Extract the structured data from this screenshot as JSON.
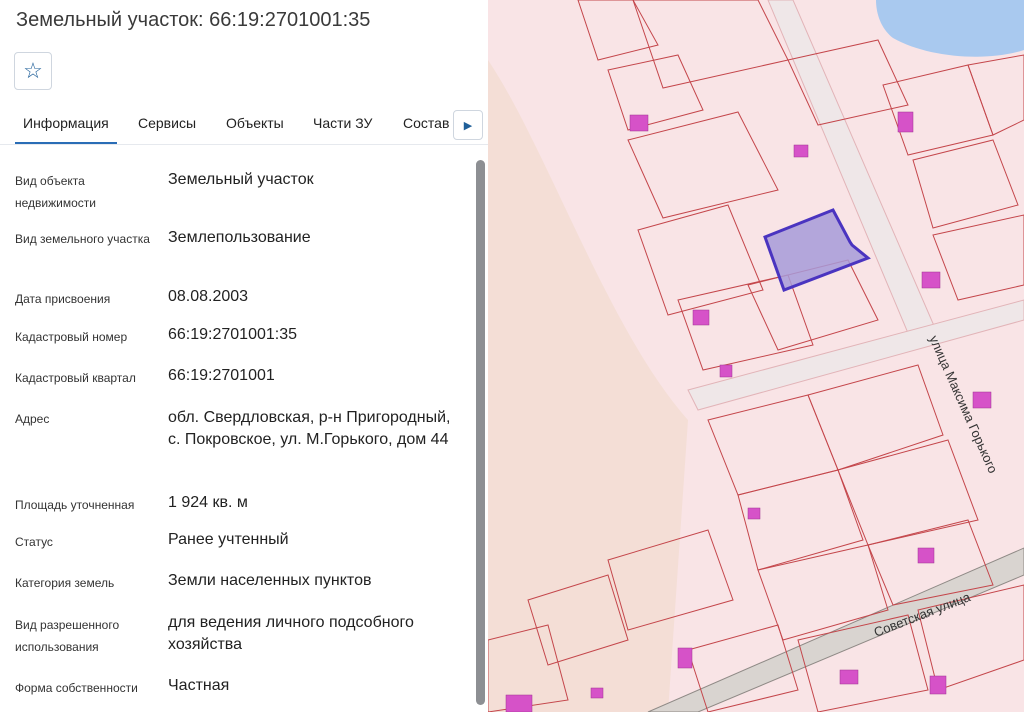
{
  "header": {
    "title": "Земельный участок: 66:19:2701001:35"
  },
  "toolbar": {
    "favorite_icon": "star-icon"
  },
  "tabs": [
    {
      "label": "Информация",
      "active": true
    },
    {
      "label": "Сервисы"
    },
    {
      "label": "Объекты"
    },
    {
      "label": "Части ЗУ"
    },
    {
      "label": "Состав"
    }
  ],
  "tabs_next_icon": "chevron-right-icon",
  "info": {
    "rows": [
      {
        "label": "Вид объекта недвижимости",
        "value": "Земельный участок"
      },
      {
        "label": "Вид земельного участка",
        "value": "Землепользование"
      },
      {
        "label": "Дата присвоения",
        "value": "08.08.2003"
      },
      {
        "label": "Кадастровый номер",
        "value": "66:19:2701001:35"
      },
      {
        "label": "Кадастровый квартал",
        "value": "66:19:2701001"
      },
      {
        "label": "Адрес",
        "value": "обл. Свердловская, р-н Пригородный, с. Покровское, ул. М.Горького, дом 44"
      },
      {
        "label": "Площадь уточненная",
        "value": "1 924 кв. м"
      },
      {
        "label": "Статус",
        "value": "Ранее учтенный"
      },
      {
        "label": "Категория земель",
        "value": "Земли населенных пунктов"
      },
      {
        "label": "Вид разрешенного использования",
        "value": "для ведения личного подсобного хозяйства"
      },
      {
        "label": "Форма собственности",
        "value": "Частная"
      }
    ]
  },
  "map": {
    "street_1": "улица Максима Горького",
    "street_2": "Советская улица",
    "colors": {
      "background": "#f9e4e6",
      "parcel_border": "#c4464b",
      "highlight_fill": "#a79bd8",
      "highlight_border": "#4a34c0",
      "building": "#d652c8",
      "road": "#efe7e8",
      "water": "#a9c9ef"
    }
  }
}
